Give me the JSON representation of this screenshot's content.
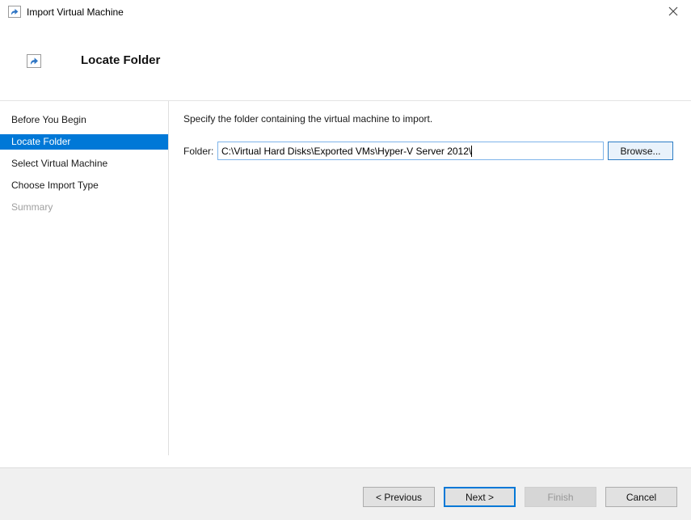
{
  "window": {
    "title": "Import Virtual Machine",
    "icon": "import-arrow-icon",
    "close_icon": "close-icon"
  },
  "header": {
    "icon": "import-arrow-icon",
    "title": "Locate Folder"
  },
  "sidebar": {
    "items": [
      {
        "label": "Before You Begin",
        "state": "normal"
      },
      {
        "label": "Locate Folder",
        "state": "selected"
      },
      {
        "label": "Select Virtual Machine",
        "state": "normal"
      },
      {
        "label": "Choose Import Type",
        "state": "normal"
      },
      {
        "label": "Summary",
        "state": "disabled"
      }
    ]
  },
  "main": {
    "instruction": "Specify the folder containing the virtual machine to import.",
    "folder_label": "Folder:",
    "folder_value": "C:\\Virtual Hard Disks\\Exported VMs\\Hyper-V Server 2012\\",
    "browse_label": "Browse..."
  },
  "footer": {
    "buttons": [
      {
        "label": "< Previous",
        "state": "normal"
      },
      {
        "label": "Next >",
        "state": "default-focused"
      },
      {
        "label": "Finish",
        "state": "disabled"
      },
      {
        "label": "Cancel",
        "state": "normal"
      }
    ]
  },
  "colors": {
    "accent": "#0078d7",
    "selected_item_bg": "#0078d7",
    "footer_bg": "#f0f0f0",
    "button_bg": "#e1e1e1",
    "browse_button_bg": "#e9f2fb",
    "input_focus_border": "#7eb4ea",
    "disabled_text": "#9f9f9f"
  }
}
